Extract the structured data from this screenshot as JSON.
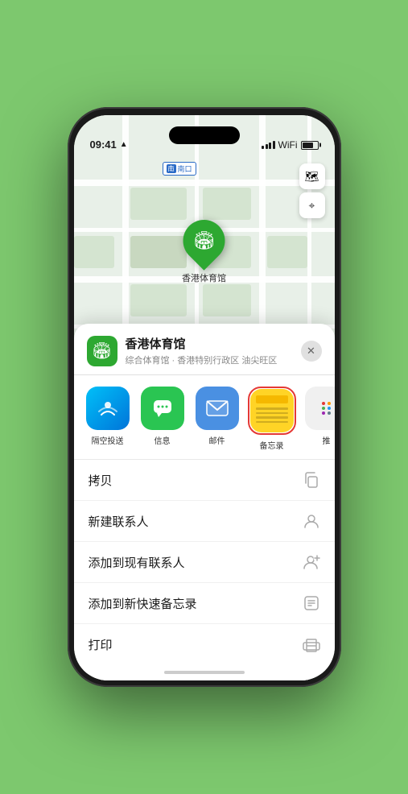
{
  "status_bar": {
    "time": "09:41",
    "location_arrow": "▲"
  },
  "map": {
    "label_text": "南口",
    "label_prefix": "南",
    "pin_label": "香港体育馆"
  },
  "map_controls": {
    "layers_icon": "🗺",
    "location_icon": "➤"
  },
  "venue": {
    "name": "香港体育馆",
    "subtitle": "综合体育馆 · 香港特别行政区 油尖旺区",
    "close_label": "✕"
  },
  "share_items": [
    {
      "id": "airdrop",
      "label": "隔空投送"
    },
    {
      "id": "messages",
      "label": "信息"
    },
    {
      "id": "mail",
      "label": "邮件"
    },
    {
      "id": "notes",
      "label": "备忘录"
    },
    {
      "id": "more",
      "label": "推"
    }
  ],
  "actions": [
    {
      "label": "拷贝",
      "icon": "copy"
    },
    {
      "label": "新建联系人",
      "icon": "person"
    },
    {
      "label": "添加到现有联系人",
      "icon": "person-add"
    },
    {
      "label": "添加到新快速备忘录",
      "icon": "memo"
    },
    {
      "label": "打印",
      "icon": "print"
    }
  ]
}
